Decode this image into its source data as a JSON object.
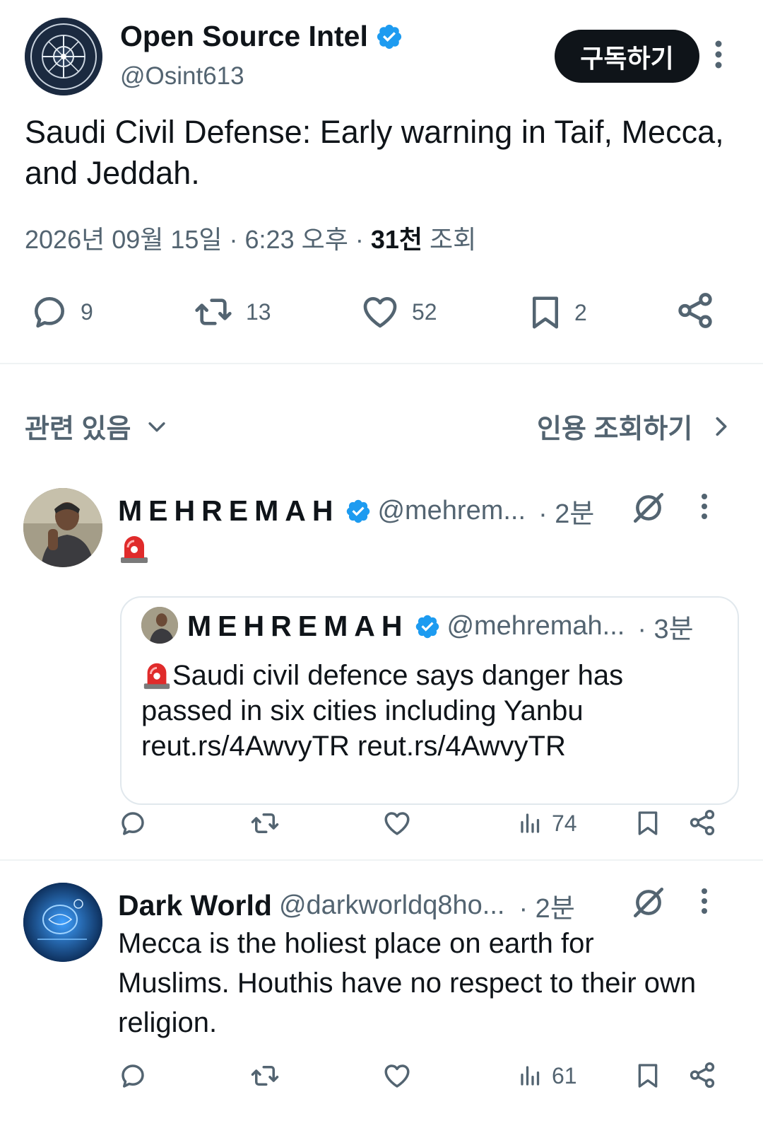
{
  "main_tweet": {
    "display_name": "Open Source Intel",
    "handle": "@Osint613",
    "subscribe_label": "구독하기",
    "text": "Saudi Civil Defense: Early warning in Taif, Mecca, and Jeddah.",
    "date": "2026년 09월 15일 · 6:23 오후 · ",
    "views_count": "31천",
    "views_label": " 조회",
    "stats": {
      "replies": "9",
      "retweets": "13",
      "likes": "52",
      "bookmarks": "2"
    }
  },
  "related": {
    "label": "관련 있음",
    "quotes_label": "인용 조회하기"
  },
  "replies": [
    {
      "display_name": "MEHREMAH",
      "handle": "@mehrem...",
      "time": "· 2분",
      "quote": {
        "display_name": "MEHREMAH",
        "handle": "@mehremah...",
        "time": "· 3분",
        "text_line1": "Saudi civil defence says danger has",
        "text_line2": "passed in six cities including Yanbu",
        "text_line3": "reut.rs/4AwvyTR reut.rs/4AwvyTR"
      },
      "views": "74"
    },
    {
      "display_name": "Dark World",
      "handle": "@darkworldq8ho...",
      "time": "· 2분",
      "text": "Mecca is the holiest place on earth for Muslims. Houthis have no respect to their own religion.",
      "views": "61"
    }
  ],
  "colors": {
    "primary_text": "#0f1419",
    "secondary_text": "#536471",
    "verified": "#1d9bf0",
    "divider": "#eff3f4"
  }
}
